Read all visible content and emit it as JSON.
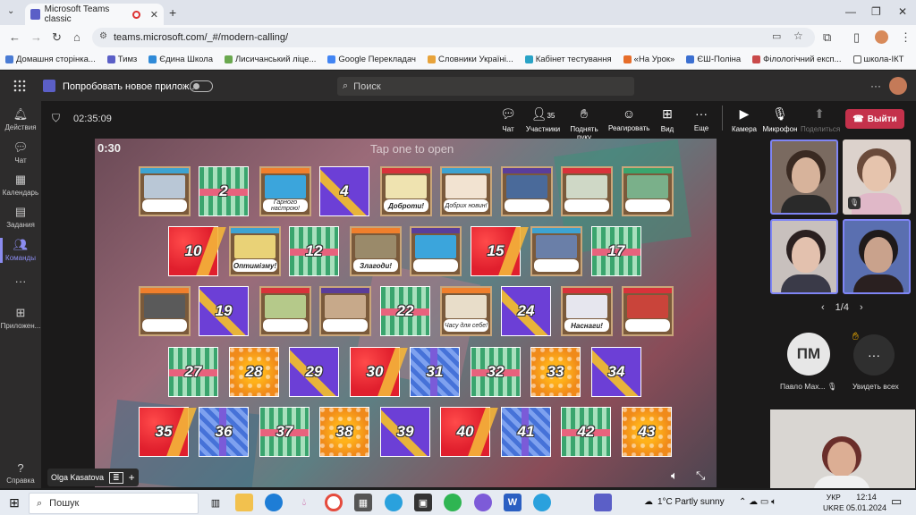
{
  "browser": {
    "tab_title": "Microsoft Teams classic",
    "url": "teams.microsoft.com/_#/modern-calling/",
    "bookmarks": [
      "Домашня сторінка...",
      "Тимз",
      "Єдина Школа",
      "Лисичанський ліце...",
      "Google Перекладач",
      "Словники Україні...",
      "Кабінет тестування",
      "«На Урок»",
      "ЄШ-Поліна",
      "Філологічний експ...",
      "школа-ІКТ"
    ]
  },
  "teams": {
    "new_app_label": "Попробовать новое прилож...",
    "search_placeholder": "Поиск",
    "rail": [
      {
        "label": "Действия",
        "icon": "bell-icon"
      },
      {
        "label": "Чат",
        "icon": "chat-icon"
      },
      {
        "label": "Календарь",
        "icon": "calendar-icon"
      },
      {
        "label": "Задания",
        "icon": "assignments-icon"
      },
      {
        "label": "Команды",
        "icon": "teams-icon",
        "active": true
      },
      {
        "label": "Приложен...",
        "icon": "apps-icon"
      },
      {
        "label": "Справка",
        "icon": "help-icon"
      }
    ]
  },
  "meeting": {
    "timer": "02:35:09",
    "controls": {
      "chat": "Чат",
      "participants": "Участники",
      "participants_count": "35",
      "raise_hand": "Поднять руку",
      "react": "Реагировать",
      "view": "Вид",
      "more": "Еще",
      "camera": "Камера",
      "mic": "Микрофон",
      "share": "Поделиться",
      "leave": "Выйти"
    },
    "presenter_name": "Olga Kasatova",
    "pager": "1/4",
    "participant_name": "Павло Мах...",
    "participant_initials": "ПМ",
    "see_all": "Увидеть всех"
  },
  "game": {
    "countdown": "0:30",
    "instruction": "Tap one to open",
    "tiles": [
      {
        "kind": "card",
        "caption": "",
        "ribbon": "#3da3d1",
        "pic": "#b9c7d6"
      },
      {
        "kind": "number",
        "label": "2",
        "style": "green"
      },
      {
        "kind": "card",
        "caption": "Гарного настрою!",
        "ribbon": "#f07f2c",
        "pic": "#3ba5dc"
      },
      {
        "kind": "number",
        "label": "4",
        "style": "purple"
      },
      {
        "kind": "card",
        "caption": "Доброти!",
        "ribbon": "#d8323a",
        "pic": "#efe3b0",
        "big": true
      },
      {
        "kind": "card",
        "caption": "Добрих новин!",
        "ribbon": "#3da3d1",
        "pic": "#f2e3d1"
      },
      {
        "kind": "card",
        "caption": "",
        "ribbon": "#5a3d9a",
        "pic": "#4a6a9a"
      },
      {
        "kind": "card",
        "caption": "",
        "ribbon": "#d8323a",
        "pic": "#cfd8c6"
      },
      {
        "kind": "card",
        "caption": "",
        "ribbon": "#3aa56e",
        "pic": "#7ab08a"
      },
      {
        "kind": "number",
        "label": "10",
        "style": "red"
      },
      {
        "kind": "card",
        "caption": "Оптимізму!",
        "ribbon": "#3da3d1",
        "pic": "#e9d277",
        "big": true
      },
      {
        "kind": "number",
        "label": "12",
        "style": "green"
      },
      {
        "kind": "card",
        "caption": "Злагоди!",
        "ribbon": "#f07f2c",
        "pic": "#9a8a6a",
        "big": true
      },
      {
        "kind": "card",
        "caption": "",
        "ribbon": "#5a3d9a",
        "pic": "#3ba5dc"
      },
      {
        "kind": "number",
        "label": "15",
        "style": "red"
      },
      {
        "kind": "card",
        "caption": "",
        "ribbon": "#3da3d1",
        "pic": "#6a7fa8"
      },
      {
        "kind": "number",
        "label": "17",
        "style": "green"
      },
      {
        "kind": "card",
        "caption": "",
        "ribbon": "#f07f2c",
        "pic": "#5a5a5a"
      },
      {
        "kind": "number",
        "label": "19",
        "style": "purple"
      },
      {
        "kind": "card",
        "caption": "",
        "ribbon": "#d8323a",
        "pic": "#b5c98a"
      },
      {
        "kind": "card",
        "caption": "",
        "ribbon": "#5a3d9a",
        "pic": "#c7a98a"
      },
      {
        "kind": "number",
        "label": "22",
        "style": "green"
      },
      {
        "kind": "card",
        "caption": "Часу для себе!",
        "ribbon": "#f07f2c",
        "pic": "#e8ddc9"
      },
      {
        "kind": "number",
        "label": "24",
        "style": "purple"
      },
      {
        "kind": "card",
        "caption": "Наснаги!",
        "ribbon": "#d8323a",
        "pic": "#e6e6ee",
        "big": true
      },
      {
        "kind": "card",
        "caption": "",
        "ribbon": "#d8323a",
        "pic": "#c9443a"
      },
      {
        "kind": "number",
        "label": "27",
        "style": "green"
      },
      {
        "kind": "number",
        "label": "28",
        "style": "orange"
      },
      {
        "kind": "number",
        "label": "29",
        "style": "purple"
      },
      {
        "kind": "number",
        "label": "30",
        "style": "red"
      },
      {
        "kind": "number",
        "label": "31",
        "style": "blue"
      },
      {
        "kind": "number",
        "label": "32",
        "style": "green"
      },
      {
        "kind": "number",
        "label": "33",
        "style": "orange"
      },
      {
        "kind": "number",
        "label": "34",
        "style": "purple"
      },
      {
        "kind": "number",
        "label": "35",
        "style": "red"
      },
      {
        "kind": "number",
        "label": "36",
        "style": "blue"
      },
      {
        "kind": "number",
        "label": "37",
        "style": "green"
      },
      {
        "kind": "number",
        "label": "38",
        "style": "orange"
      },
      {
        "kind": "number",
        "label": "39",
        "style": "purple"
      },
      {
        "kind": "number",
        "label": "40",
        "style": "red"
      },
      {
        "kind": "number",
        "label": "41",
        "style": "blue"
      },
      {
        "kind": "number",
        "label": "42",
        "style": "green"
      },
      {
        "kind": "number",
        "label": "43",
        "style": "orange"
      }
    ]
  },
  "taskbar": {
    "search_label": "Пошук",
    "weather": "1°C  Partly sunny",
    "lang_top": "УКР",
    "lang_bottom": "UKRE",
    "time": "12:14",
    "date": "05.01.2024"
  }
}
